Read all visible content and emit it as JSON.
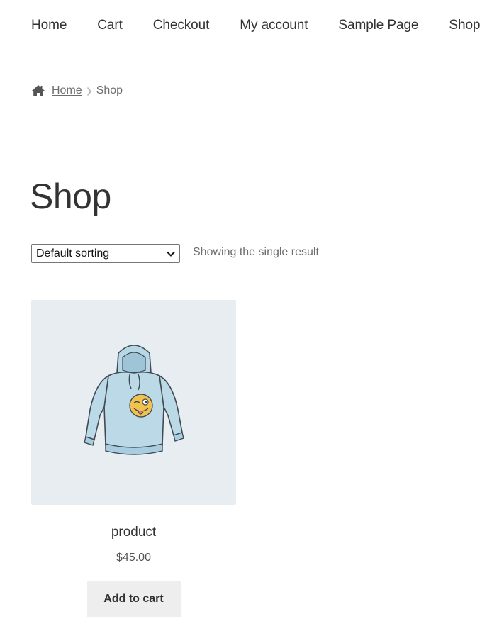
{
  "nav": {
    "items": [
      {
        "label": "Home"
      },
      {
        "label": "Cart"
      },
      {
        "label": "Checkout"
      },
      {
        "label": "My account"
      },
      {
        "label": "Sample Page"
      },
      {
        "label": "Shop"
      }
    ]
  },
  "breadcrumb": {
    "home_label": "Home",
    "current": "Shop",
    "icon": "home-icon"
  },
  "page": {
    "title": "Shop"
  },
  "toolbar": {
    "sort_selected": "Default sorting",
    "result_count": "Showing the single result"
  },
  "products": [
    {
      "name": "product",
      "price": "$45.00",
      "button_label": "Add to cart",
      "image": "hoodie-with-emoji-image"
    }
  ],
  "colors": {
    "thumb_bg": "#e8edf1",
    "button_bg": "#eeeeee",
    "text": "#333333",
    "muted": "#6d6d6d"
  }
}
